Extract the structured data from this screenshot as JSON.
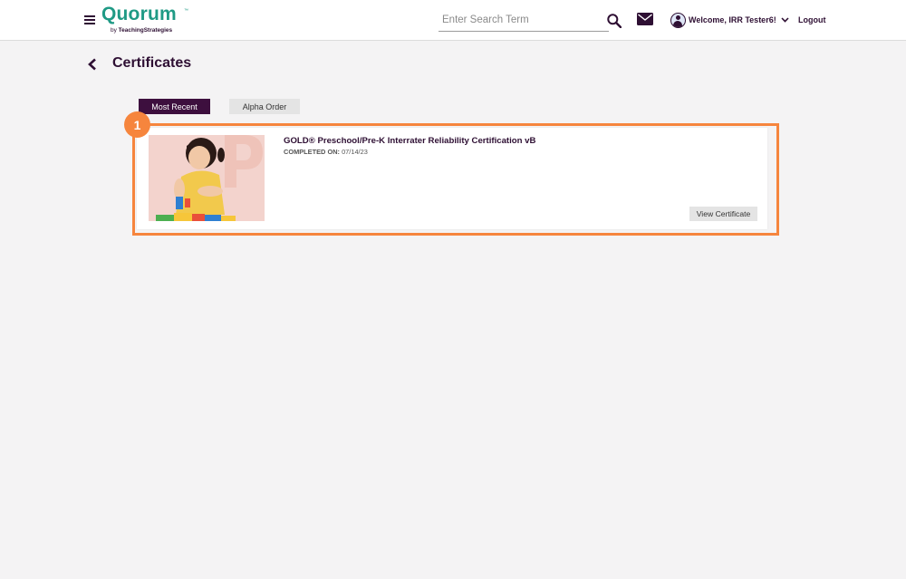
{
  "header": {
    "logo": {
      "word": "Quorum",
      "tm": "™",
      "by_prefix": "by ",
      "by_brand": "TeachingStrategies"
    },
    "search": {
      "placeholder": "Enter Search Term",
      "value": ""
    },
    "user": {
      "welcome": "Welcome, IRR Tester6!"
    },
    "logout_label": "Logout",
    "icons": [
      "hamburger-menu-icon",
      "search-icon",
      "mail-icon",
      "user-avatar-icon",
      "chevron-down-icon"
    ]
  },
  "page": {
    "title": "Certificates",
    "tabs": [
      {
        "label": "Most Recent",
        "active": true
      },
      {
        "label": "Alpha Order",
        "active": false
      }
    ],
    "step_badge": "1",
    "certificates": [
      {
        "title": "GOLD® Preschool/Pre-K Interrater Reliability Certification vB",
        "completed_label": "COMPLETED ON:",
        "completed_date": "07/14/23",
        "button_label": "View Certificate"
      }
    ]
  },
  "colors": {
    "brand_green": "#1f9a85",
    "brand_purple": "#2e0f33",
    "tab_active": "#3d0f3e",
    "highlight_orange": "#f6853d",
    "background": "#f4f3f4"
  }
}
